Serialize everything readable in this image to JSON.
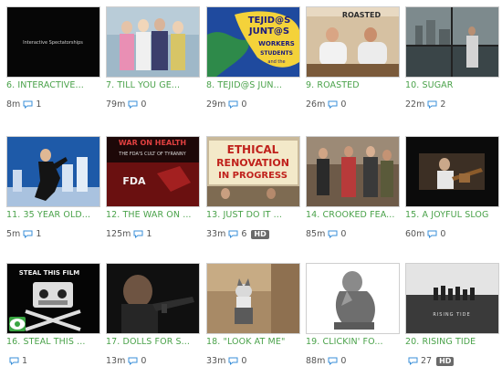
{
  "videos": [
    {
      "title": "6. INTERACTIVE...",
      "duration": "8m",
      "comments": "1",
      "hd": false,
      "thumb_text": "Interactive Spectatorships"
    },
    {
      "title": "7. TILL YOU GE...",
      "duration": "79m",
      "comments": "0",
      "hd": false
    },
    {
      "title": "8. TEJID@S JUN...",
      "duration": "29m",
      "comments": "0",
      "hd": false,
      "thumb_lines": [
        "TEJID@S",
        "JUNT@S",
        "WORKERS",
        "STUDENTS",
        "and the"
      ]
    },
    {
      "title": "9. ROASTED",
      "duration": "26m",
      "comments": "0",
      "hd": false,
      "thumb_text": "ROASTED"
    },
    {
      "title": "10. SUGAR",
      "duration": "22m",
      "comments": "2",
      "hd": false
    },
    {
      "title": "11. 35 YEAR OLD...",
      "duration": "5m",
      "comments": "1",
      "hd": false
    },
    {
      "title": "12. THE WAR ON ...",
      "duration": "125m",
      "comments": "1",
      "hd": false,
      "thumb_lines": [
        "WAR ON HEALTH",
        "THE FDA'S CULT OF TYRANNY",
        "FDA"
      ]
    },
    {
      "title": "13. JUST DO IT ...",
      "duration": "33m",
      "comments": "6",
      "hd": true,
      "thumb_lines": [
        "ETHICAL",
        "RENOVATION",
        "IN PROGRESS"
      ]
    },
    {
      "title": "14. CROOKED FEA...",
      "duration": "85m",
      "comments": "0",
      "hd": false
    },
    {
      "title": "15. A JOYFUL SLOG",
      "duration": "60m",
      "comments": "0",
      "hd": false
    },
    {
      "title": "16. STEAL THIS ...",
      "duration": "",
      "comments": "1",
      "hd": false,
      "thumb_text": "STEAL THIS FILM"
    },
    {
      "title": "17. DOLLS FOR S...",
      "duration": "13m",
      "comments": "0",
      "hd": false
    },
    {
      "title": "18. \"LOOK AT ME\"",
      "duration": "33m",
      "comments": "0",
      "hd": false
    },
    {
      "title": "19. CLICKIN' FO...",
      "duration": "88m",
      "comments": "0",
      "hd": false
    },
    {
      "title": "20. RISING TIDE",
      "duration": "",
      "comments": "27",
      "hd": true,
      "thumb_text": "RISING TIDE"
    }
  ],
  "hd_label": "HD",
  "colors": {
    "title": "#4aa24a",
    "meta": "#555555",
    "comment_icon": "#3a8fd8",
    "eye_badge": "#3aa542"
  }
}
